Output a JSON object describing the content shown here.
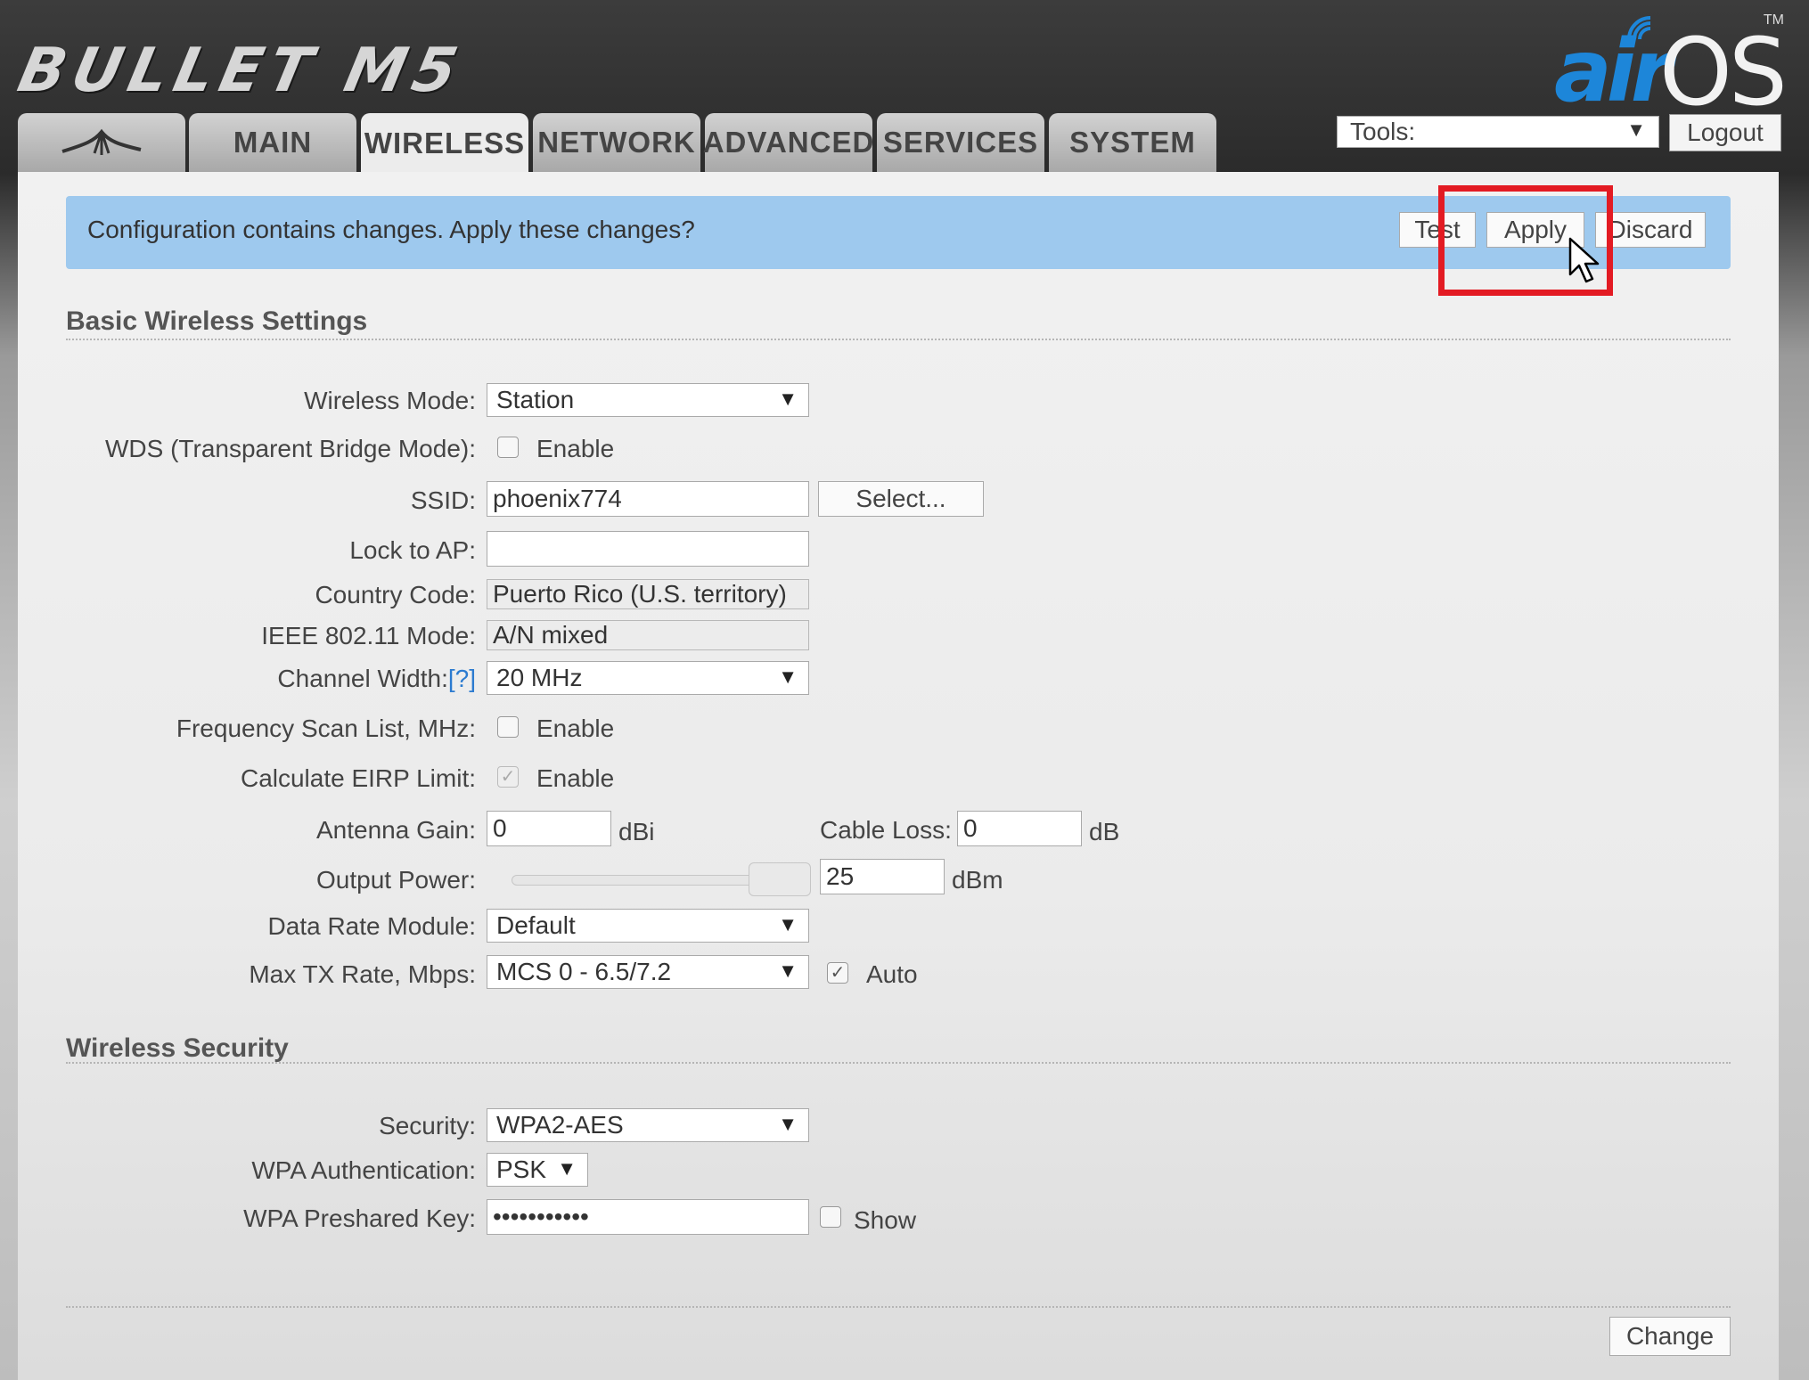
{
  "header": {
    "product_name": "BULLET M5",
    "brand_air": "air",
    "brand_os": "OS",
    "brand_tm": "TM"
  },
  "tabs": [
    {
      "label": "",
      "icon": "ubiquiti-logo-icon"
    },
    {
      "label": "MAIN"
    },
    {
      "label": "WIRELESS",
      "active": true
    },
    {
      "label": "NETWORK"
    },
    {
      "label": "ADVANCED"
    },
    {
      "label": "SERVICES"
    },
    {
      "label": "SYSTEM"
    }
  ],
  "toolbar": {
    "tools_label": "Tools:",
    "logout_label": "Logout"
  },
  "banner": {
    "message": "Configuration contains changes. Apply these changes?",
    "test_label": "Test",
    "apply_label": "Apply",
    "discard_label": "Discard"
  },
  "basic": {
    "title": "Basic Wireless Settings",
    "wireless_mode_label": "Wireless Mode:",
    "wireless_mode_value": "Station",
    "wds_label": "WDS (Transparent Bridge Mode):",
    "wds_enable": "Enable",
    "ssid_label": "SSID:",
    "ssid_value": "phoenix774",
    "select_label": "Select...",
    "lock_ap_label": "Lock to AP:",
    "lock_ap_value": "",
    "country_label": "Country Code:",
    "country_value": "Puerto Rico (U.S. territory)",
    "ieee_label": "IEEE 802.11 Mode:",
    "ieee_value": "A/N mixed",
    "channel_width_label": "Channel Width:",
    "channel_width_help": "[?]",
    "channel_width_value": "20 MHz",
    "freq_scan_label": "Frequency Scan List, MHz:",
    "freq_scan_enable": "Enable",
    "eirp_label": "Calculate EIRP Limit:",
    "eirp_enable": "Enable",
    "antenna_gain_label": "Antenna Gain:",
    "antenna_gain_value": "0",
    "antenna_gain_unit": "dBi",
    "cable_loss_label": "Cable Loss:",
    "cable_loss_value": "0",
    "cable_loss_unit": "dB",
    "output_power_label": "Output Power:",
    "output_power_value": "25",
    "output_power_unit": "dBm",
    "data_rate_label": "Data Rate Module:",
    "data_rate_value": "Default",
    "max_tx_label": "Max TX Rate, Mbps:",
    "max_tx_value": "MCS 0 - 6.5/7.2",
    "max_tx_auto": "Auto"
  },
  "security": {
    "title": "Wireless Security",
    "security_label": "Security:",
    "security_value": "WPA2-AES",
    "wpa_auth_label": "WPA Authentication:",
    "wpa_auth_value": "PSK",
    "psk_label": "WPA Preshared Key:",
    "psk_value": "•••••••••••",
    "show_label": "Show"
  },
  "footer": {
    "change_label": "Change"
  },
  "colors": {
    "banner_bg": "#9ec9ee",
    "highlight": "#e31b23",
    "brand_blue": "#1d86d9"
  }
}
